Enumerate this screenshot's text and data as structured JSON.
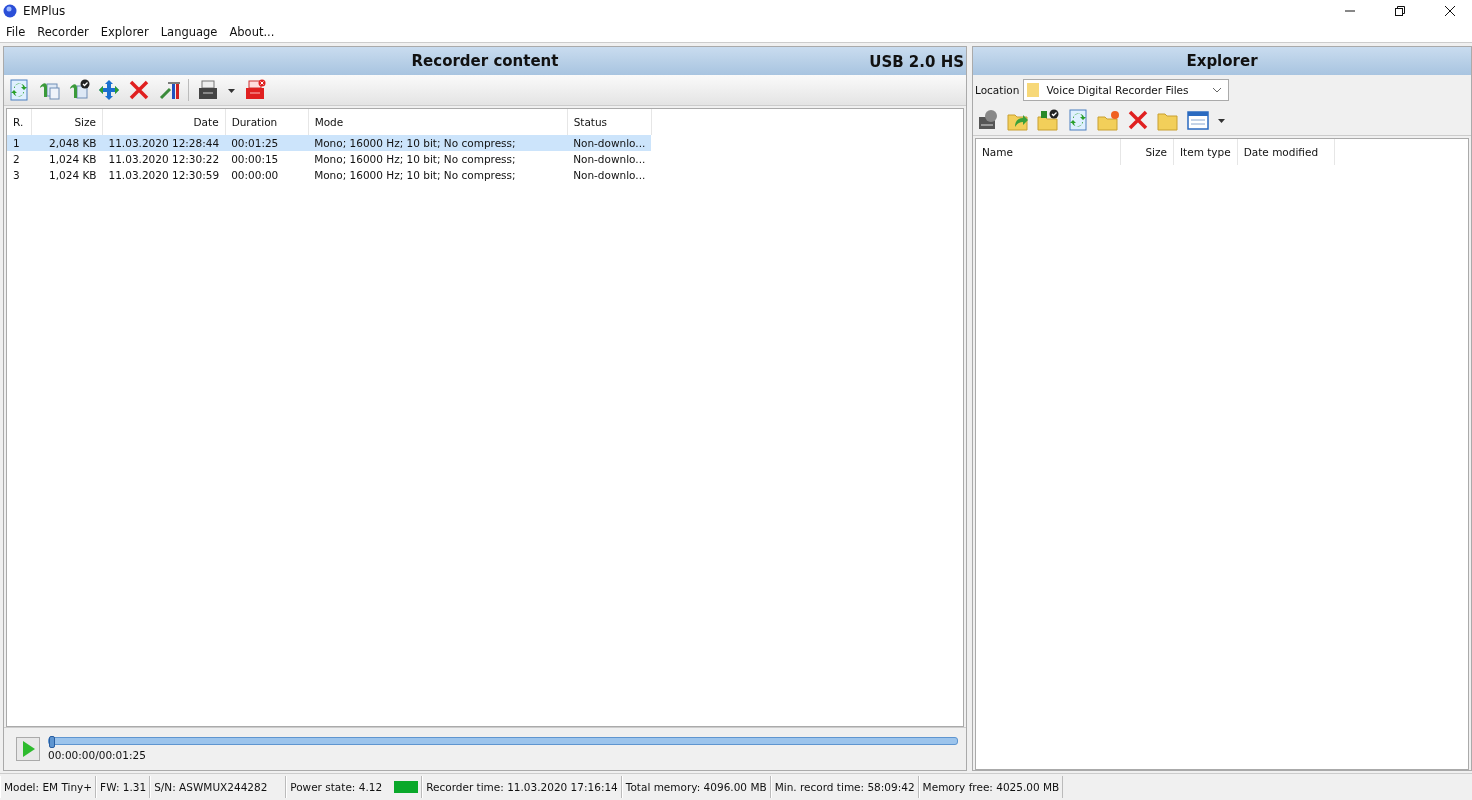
{
  "window": {
    "title": "EMPlus"
  },
  "menu": [
    "File",
    "Recorder",
    "Explorer",
    "Language",
    "About..."
  ],
  "recorder": {
    "title": "Recorder content",
    "connection": "USB 2.0 HS",
    "columns": [
      "R.",
      "Size",
      "Date",
      "Duration",
      "Mode",
      "Status"
    ],
    "rows": [
      {
        "selected": true,
        "cells": [
          "1",
          "2,048 KB",
          "11.03.2020 12:28:44",
          "00:01:25",
          "Mono; 16000 Hz; 10 bit; No compress;",
          "Non-downlo..."
        ]
      },
      {
        "selected": false,
        "cells": [
          "2",
          "1,024 KB",
          "11.03.2020 12:30:22",
          "00:00:15",
          "Mono; 16000 Hz; 10 bit; No compress;",
          "Non-downlo..."
        ]
      },
      {
        "selected": false,
        "cells": [
          "3",
          "1,024 KB",
          "11.03.2020 12:30:59",
          "00:00:00",
          "Mono; 16000 Hz; 10 bit; No compress;",
          "Non-downlo..."
        ]
      }
    ],
    "player": {
      "level": 0,
      "time": "00:00:00/00:01:25"
    }
  },
  "explorer": {
    "title": "Explorer",
    "location_label": "Location",
    "location": "Voice Digital Recorder Files",
    "columns": [
      "Name",
      "Size",
      "Item type",
      "Date modified"
    ]
  },
  "status_bar": [
    "Model: EM Tiny+",
    "FW: 1.31",
    "S/N: ASWMUX244282",
    "Power state: 4.12",
    "Recorder time: 11.03.2020 17:16:14",
    "Total memory: 4096.00 MB",
    "Min. record time: 58:09:42",
    "Memory free: 4025.00 MB"
  ]
}
